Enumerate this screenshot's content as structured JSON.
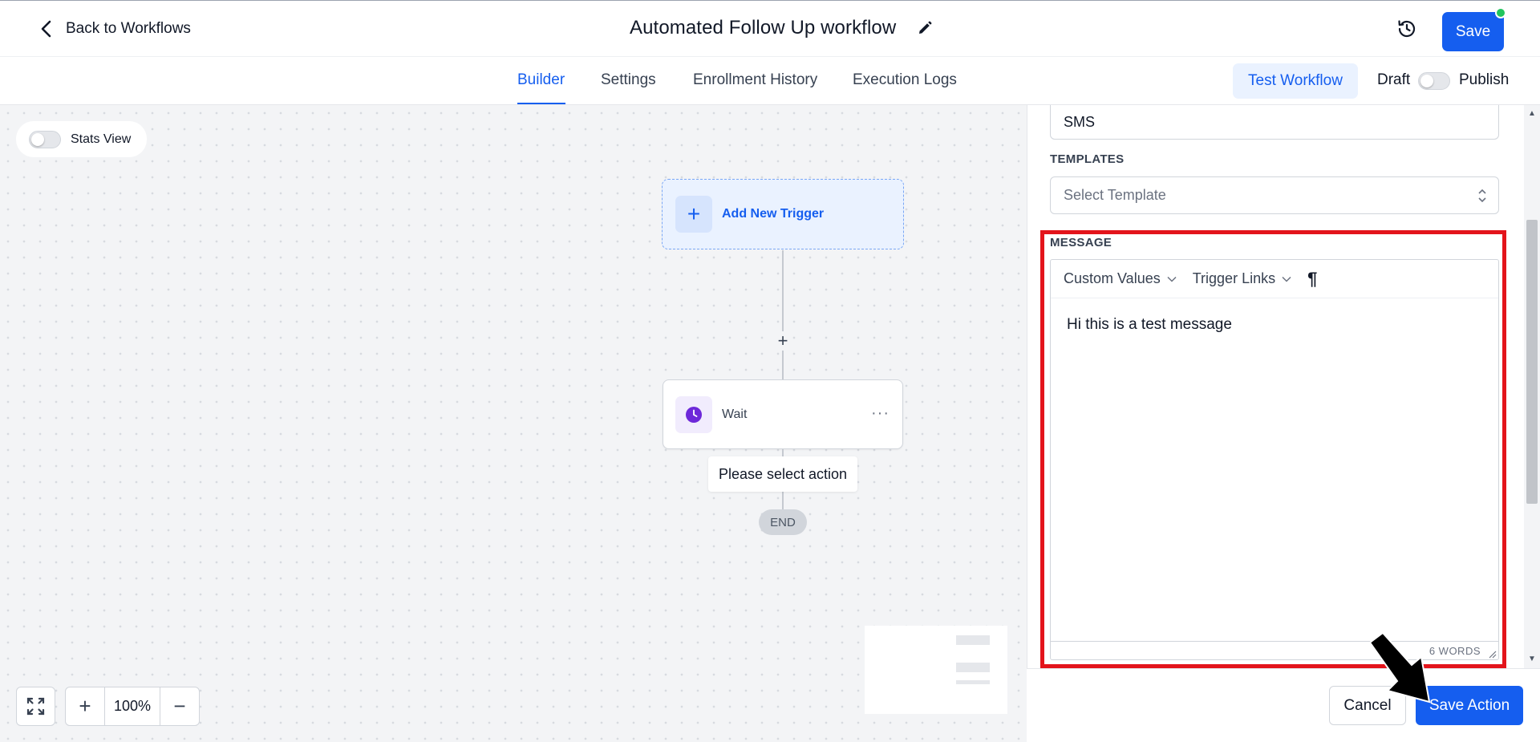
{
  "header": {
    "back_label": "Back to Workflows",
    "title": "Automated Follow Up workflow",
    "save_label": "Save"
  },
  "tabs": [
    {
      "label": "Builder",
      "active": true
    },
    {
      "label": "Settings",
      "active": false
    },
    {
      "label": "Enrollment History",
      "active": false
    },
    {
      "label": "Execution Logs",
      "active": false
    }
  ],
  "tabbar": {
    "test_label": "Test Workflow",
    "draft_label": "Draft",
    "publish_label": "Publish",
    "published": false
  },
  "canvas": {
    "stats_label": "Stats View",
    "stats_on": false,
    "trigger_label": "Add New Trigger",
    "add_step_symbol": "+",
    "wait_label": "Wait",
    "wait_menu": "···",
    "please_label": "Please select action",
    "end_label": "END",
    "zoom_level": "100%",
    "zoom_in": "+",
    "zoom_out": "−"
  },
  "panel": {
    "channel_value": "SMS",
    "templates_label": "TEMPLATES",
    "template_placeholder": "Select Template",
    "message_label": "MESSAGE",
    "toolbar": {
      "custom_values": "Custom Values",
      "trigger_links": "Trigger Links",
      "pilcrow": "¶"
    },
    "message_text": "Hi this is a test message",
    "word_count": "6 WORDS",
    "cancel_label": "Cancel",
    "save_action_label": "Save Action"
  },
  "colors": {
    "accent": "#155eef",
    "highlight_border": "#e3141b",
    "online_dot": "#22c55e",
    "wait_icon": "#6d28d9"
  },
  "icons": [
    "chevron-left-icon",
    "pencil-icon",
    "history-icon",
    "plus-icon",
    "clock-icon",
    "more-dots-icon",
    "fullscreen-icon",
    "chevron-down-icon",
    "pilcrow-icon",
    "updown-arrows-icon",
    "resize-handle-icon",
    "pointer-arrow-icon"
  ]
}
